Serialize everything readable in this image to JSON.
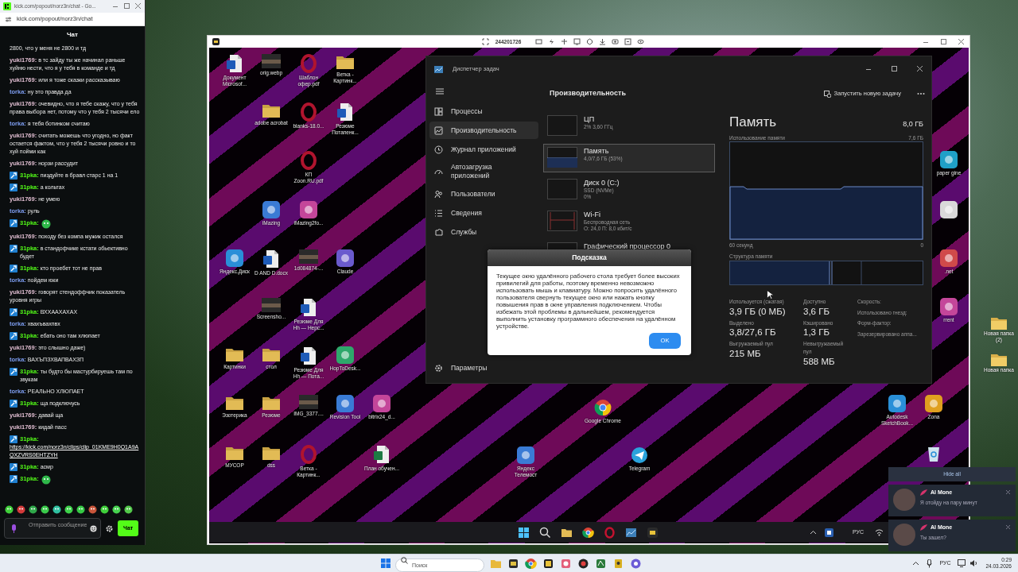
{
  "chat_window": {
    "title": "kick.com/popout/norz3n/chat - Go...",
    "url": "kick.com/popout/norz3n/chat",
    "header": "Чат",
    "messages": [
      {
        "kind": "continuation",
        "text": "2800, что у меня не 2800 и тд"
      },
      {
        "kind": "message",
        "user": "yuki1769:",
        "color": "#e2bfd3",
        "badge": false,
        "text": "в тс зайду ты же начинал раньше хуйню нести, что я у тебя в команде и тд"
      },
      {
        "kind": "message",
        "user": "yuki1769:",
        "color": "#e2bfd3",
        "badge": false,
        "text": "или я тоже сказки рассказываю"
      },
      {
        "kind": "message",
        "user": "torka:",
        "color": "#7d9df0",
        "badge": false,
        "text": "ну это правда да"
      },
      {
        "kind": "message",
        "user": "yuki1769:",
        "color": "#e2bfd3",
        "badge": false,
        "text": "очевидно, что я тебе скажу, что у тебя права выбора нет, потому что у тебя 2 тысячи ело"
      },
      {
        "kind": "message",
        "user": "torka:",
        "color": "#7d9df0",
        "badge": false,
        "text": "я тебя ботинком считаю"
      },
      {
        "kind": "message",
        "user": "yuki1769:",
        "color": "#e2bfd3",
        "badge": false,
        "text": "считать можешь что угодно, но факт остается фактом, что у тебя 2 тысячи ровно и то хуй пойми как"
      },
      {
        "kind": "message",
        "user": "yuki1769:",
        "color": "#e2bfd3",
        "badge": false,
        "text": "норзи рассудит"
      },
      {
        "kind": "message",
        "user": "31pka:",
        "color": "#53fc18",
        "badge": true,
        "text": "пиздуйте в бравл старс 1 на 1"
      },
      {
        "kind": "message",
        "user": "31pka:",
        "color": "#53fc18",
        "badge": true,
        "text": "а кольтах"
      },
      {
        "kind": "message",
        "user": "yuki1769:",
        "color": "#e2bfd3",
        "badge": false,
        "text": "не умею"
      },
      {
        "kind": "message",
        "user": "torka:",
        "color": "#7d9df0",
        "badge": false,
        "text": "руль"
      },
      {
        "kind": "emote",
        "user": "31pka:",
        "color": "#53fc18",
        "badge": true
      },
      {
        "kind": "message",
        "user": "yuki1769:",
        "color": "#e2bfd3",
        "badge": false,
        "text": "походу без компа мужик остался"
      },
      {
        "kind": "message",
        "user": "31pka:",
        "color": "#53fc18",
        "badge": true,
        "text": "в стандофчике кстати обьективно будет"
      },
      {
        "kind": "message",
        "user": "31pka:",
        "color": "#53fc18",
        "badge": true,
        "text": "кто проебет тот не прав"
      },
      {
        "kind": "message",
        "user": "torka:",
        "color": "#7d9df0",
        "badge": false,
        "text": "пойдем юки"
      },
      {
        "kind": "message",
        "user": "yuki1769:",
        "color": "#e2bfd3",
        "badge": false,
        "text": "говорят стендоффчик показатель уровня игры"
      },
      {
        "kind": "message",
        "user": "31pka:",
        "color": "#53fc18",
        "badge": true,
        "text": "ВХХААХАХАХ"
      },
      {
        "kind": "message",
        "user": "torka:",
        "color": "#7d9df0",
        "badge": false,
        "text": "хвахъвахпвх"
      },
      {
        "kind": "message",
        "user": "31pka:",
        "color": "#53fc18",
        "badge": true,
        "text": "ебать оно там хлюпает"
      },
      {
        "kind": "message",
        "user": "yuki1769:",
        "color": "#e2bfd3",
        "badge": false,
        "text": "это слышно даже)"
      },
      {
        "kind": "message",
        "user": "torka:",
        "color": "#7d9df0",
        "badge": false,
        "text": "ВАХЪПЗХВАПВАХЗП"
      },
      {
        "kind": "message",
        "user": "31pka:",
        "color": "#53fc18",
        "badge": true,
        "text": "ты будто бы мастурбируешь там по звукам"
      },
      {
        "kind": "message",
        "user": "torka:",
        "color": "#7d9df0",
        "badge": false,
        "text": "РЕАЛЬНО ХЛЮПАЕТ"
      },
      {
        "kind": "message",
        "user": "31pka:",
        "color": "#53fc18",
        "badge": true,
        "text": "ща подключусь"
      },
      {
        "kind": "message",
        "user": "yuki1769:",
        "color": "#e2bfd3",
        "badge": false,
        "text": "давай ща"
      },
      {
        "kind": "message",
        "user": "yuki1769:",
        "color": "#e2bfd3",
        "badge": false,
        "text": "кидай пасс"
      },
      {
        "kind": "link",
        "user": "31pka:",
        "color": "#53fc18",
        "badge": true,
        "text": "https://kick.com/norz3n/clips/clip_01KME9H0Q1A9AQXZVRS0EHTZYH"
      },
      {
        "kind": "message",
        "user": "31pka:",
        "color": "#53fc18",
        "badge": true,
        "text": "асмр"
      },
      {
        "kind": "emote",
        "user": "31pka:",
        "color": "#53fc18",
        "badge": true
      }
    ],
    "input": {
      "placeholder": "Отправить сообщение"
    },
    "send_button": "Чат"
  },
  "remote_window": {
    "session_id": "244201726"
  },
  "desktop_icons": [
    {
      "kind": "word",
      "label": "Документ Microsof..."
    },
    {
      "kind": "image",
      "label": "orig.webp"
    },
    {
      "kind": "opera",
      "label": "Шаблон офер.pdf"
    },
    {
      "kind": "folder",
      "label": "Ветка - Картинк..."
    },
    {
      "kind": "folder",
      "label": "adobe acrobat"
    },
    {
      "kind": "opera",
      "label": "blanks-18.0..."
    },
    {
      "kind": "word",
      "label": "Резюме Потапенк..."
    },
    {
      "kind": "opera",
      "label": "КП Zoon.RU.pdf"
    },
    {
      "kind": "app",
      "label": "paper gine"
    },
    {
      "kind": "app",
      "label": "iMazing"
    },
    {
      "kind": "app",
      "label": "iMazing2fo..."
    },
    {
      "kind": "app"
    },
    {
      "kind": "app",
      "label": "Яндекс.Диск"
    },
    {
      "kind": "word",
      "label": "D AND D.docx"
    },
    {
      "kind": "image",
      "label": "1d084874-..."
    },
    {
      "kind": "app",
      "label": "Claude"
    },
    {
      "kind": "app",
      "label": ".net"
    },
    {
      "kind": "image",
      "label": "Screensho..."
    },
    {
      "kind": "word",
      "label": "Резюме Для Hh — Нерс..."
    },
    {
      "kind": "app",
      "label": "rrent"
    },
    {
      "kind": "folder",
      "label": "Картинки"
    },
    {
      "kind": "folder",
      "label": "стол"
    },
    {
      "kind": "word",
      "label": "Резюме Для Hh — Пота..."
    },
    {
      "kind": "app",
      "label": "HopToDesk..."
    },
    {
      "kind": "folder",
      "label": "Эзотерика"
    },
    {
      "kind": "folder",
      "label": "Резюме"
    },
    {
      "kind": "image",
      "label": "IMG_3377...."
    },
    {
      "kind": "app",
      "label": "Revision Tool"
    },
    {
      "kind": "app",
      "label": "bitrix24_d..."
    },
    {
      "kind": "chrome",
      "label": "Google Chrome"
    },
    {
      "kind": "app",
      "label": "Autodesk SketchBook..."
    },
    {
      "kind": "app",
      "label": "Zona"
    },
    {
      "kind": "folder",
      "label": "МУСОР"
    },
    {
      "kind": "folder",
      "label": "dss"
    },
    {
      "kind": "opera",
      "label": "Ветка - Картинк..."
    },
    {
      "kind": "excel",
      "label": "План обучен..."
    },
    {
      "kind": "app",
      "label": "Яндекс Телемост"
    },
    {
      "kind": "telegram",
      "label": "Telegram"
    },
    {
      "kind": "bin"
    }
  ],
  "task_manager": {
    "title": "Диспетчер задач",
    "nav": [
      {
        "label": "Процессы",
        "selected": false
      },
      {
        "label": "Производительность",
        "selected": true
      },
      {
        "label": "Журнал приложений",
        "selected": false
      },
      {
        "label": "Автозагрузка приложений",
        "selected": false
      },
      {
        "label": "Пользователи",
        "selected": false
      },
      {
        "label": "Сведения",
        "selected": false
      },
      {
        "label": "Службы",
        "selected": false
      }
    ],
    "settings": "Параметры",
    "section_title": "Производительность",
    "new_task": "Запустить новую задачу",
    "resources": [
      {
        "name": "ЦП",
        "details": [
          "2% 3,60 ГГц"
        ],
        "selected": false
      },
      {
        "name": "Память",
        "details": [
          "4,0/7,6 ГБ (53%)"
        ],
        "selected": true
      },
      {
        "name": "Диск 0 (C:)",
        "details": [
          "SSD (NVMe)",
          "0%"
        ],
        "selected": false
      },
      {
        "name": "Wi-Fi",
        "details": [
          "Беспроводная сеть",
          "О: 24,0 П: 8,0 кбит/с"
        ],
        "selected": false
      },
      {
        "name": "Графический процессор 0",
        "selected": false
      }
    ],
    "detail": {
      "title": "Память",
      "total": "8,0 ГБ",
      "usage_label": "Использование памяти",
      "usage_max": "7,6 ГБ",
      "time_span": "60 секунд",
      "axis_min": "0",
      "composition_label": "Структура памяти",
      "stats": [
        {
          "label": "Используется (сжатая)",
          "value": "3,9 ГБ (0 МБ)"
        },
        {
          "label": "Доступно",
          "value": "3,6 ГБ"
        },
        {
          "label": "Выделено",
          "value": "3,8/27,6 ГБ"
        },
        {
          "label": "Кэшировано",
          "value": "1,3 ГБ"
        },
        {
          "label": "Выгружаемый пул",
          "value": "215 МБ"
        },
        {
          "label": "Невыгружаемый пул",
          "value": "588 МБ"
        }
      ],
      "properties": [
        "Скорость:",
        "Использовано гнезд:",
        "Форм-фактор:",
        "Зарезервировано аппа..."
      ]
    }
  },
  "dialog": {
    "title": "Подсказка",
    "text": "Текущее окно удалённого рабочего стола требует более высоких привилегий для работы, поэтому временно невозможно использовать мышь и клавиатуру. Можно попросить удалённого пользователя свернуть текущее окно или нажать кнопку повышения прав в окне управления подключением. Чтобы избежать этой проблемы в дальнейшем, рекомендуется выполнить установку программного обеспечения на удалённом устройстве.",
    "button": "OK"
  },
  "remote_taskbar": {
    "language": "РУС"
  },
  "host_desktop_icons": [
    {
      "label": "Новая папка (2)"
    },
    {
      "label": "Новая папка"
    }
  ],
  "notifications": {
    "hide_all": "Hide all",
    "items": [
      {
        "sender": "Al Mone",
        "text": "Я отойду на пару минут"
      },
      {
        "sender": "Al Mone",
        "text": "Ты зашел?"
      }
    ]
  },
  "taskbar": {
    "search_placeholder": "Поиск",
    "language": "РУС",
    "time": "0:29",
    "date": "24.03.2026"
  }
}
